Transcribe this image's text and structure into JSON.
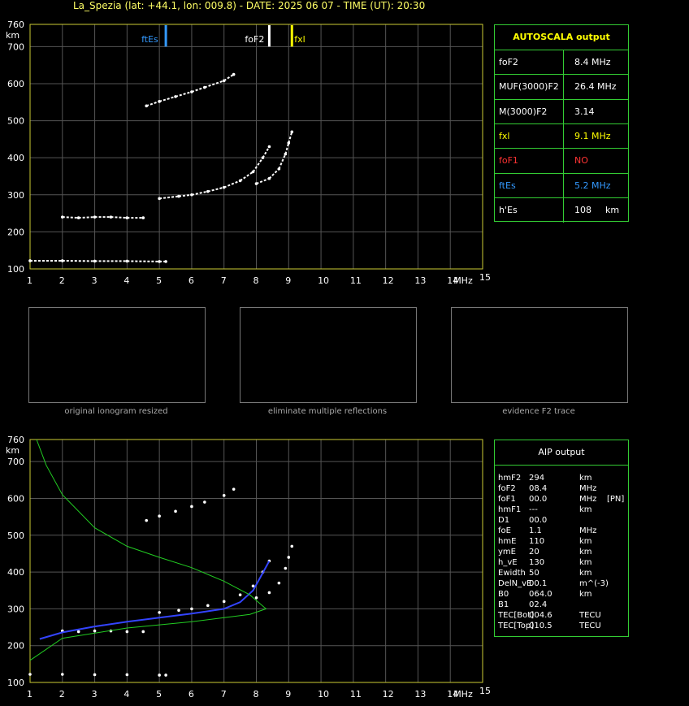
{
  "title": "La_Spezia (lat: +44.1, lon: 009.8) - DATE: 2025 06 07 - TIME (UT): 20:30",
  "axis": {
    "y_unit": "km",
    "x_unit": "MHz",
    "y_ticks": [
      "100",
      "200",
      "300",
      "400",
      "500",
      "600",
      "700",
      "760"
    ],
    "x_ticks": [
      "1",
      "2",
      "3",
      "4",
      "5",
      "6",
      "7",
      "8",
      "9",
      "10",
      "11",
      "12",
      "13",
      "14",
      "15"
    ]
  },
  "markers": {
    "ftEs": {
      "label": "ftEs",
      "freq": 5.2,
      "color": "#3399ff"
    },
    "foF2": {
      "label": "foF2",
      "freq": 8.4,
      "color": "#ffffff"
    },
    "fxl": {
      "label": "fxl",
      "freq": 9.1,
      "color": "#ffff00"
    }
  },
  "autoscala": {
    "header": "AUTOSCALA output",
    "rows": [
      {
        "name": "foF2",
        "value": "8.4 MHz",
        "name_color": "#ffffff",
        "value_color": "#ffffff"
      },
      {
        "name": "MUF(3000)F2",
        "value": "26.4 MHz",
        "name_color": "#ffffff",
        "value_color": "#ffffff"
      },
      {
        "name": "M(3000)F2",
        "value": "3.14",
        "name_color": "#ffffff",
        "value_color": "#ffffff"
      },
      {
        "name": "fxl",
        "value": "9.1 MHz",
        "name_color": "#ffff00",
        "value_color": "#ffff00"
      },
      {
        "name": "foF1",
        "value": "NO",
        "name_color": "#ff3333",
        "value_color": "#ff3333"
      },
      {
        "name": "ftEs",
        "value": "5.2 MHz",
        "name_color": "#3399ff",
        "value_color": "#3399ff"
      },
      {
        "name": "h'Es",
        "value": "108",
        "unit": "km",
        "name_color": "#ffffff",
        "value_color": "#ffffff"
      }
    ]
  },
  "thumb_captions": [
    "original ionogram resized",
    "eliminate multiple reflections",
    "evidence F2 trace"
  ],
  "aip": {
    "header": "AIP output",
    "rows": [
      {
        "name": "hmF2",
        "value": "294",
        "unit": "km",
        "extra": ""
      },
      {
        "name": "foF2",
        "value": "08.4",
        "unit": "MHz",
        "extra": ""
      },
      {
        "name": "foF1",
        "value": "00.0",
        "unit": "MHz",
        "extra": "[PN]"
      },
      {
        "name": "hmF1",
        "value": "---",
        "unit": "km",
        "extra": ""
      },
      {
        "name": "D1",
        "value": "00.0",
        "unit": "",
        "extra": ""
      },
      {
        "name": "foE",
        "value": "1.1",
        "unit": "MHz",
        "extra": ""
      },
      {
        "name": "hmE",
        "value": "110",
        "unit": "km",
        "extra": ""
      },
      {
        "name": "ymE",
        "value": "20",
        "unit": "km",
        "extra": ""
      },
      {
        "name": "h_vE",
        "value": "130",
        "unit": "km",
        "extra": ""
      },
      {
        "name": "Ewidth",
        "value": "50",
        "unit": "km",
        "extra": ""
      },
      {
        "name": "DelN_vE",
        "value": "00.1",
        "unit": "m^(-3)",
        "extra": ""
      },
      {
        "name": "B0",
        "value": "064.0",
        "unit": "km",
        "extra": ""
      },
      {
        "name": "B1",
        "value": "02.4",
        "unit": "",
        "extra": ""
      },
      {
        "name": "TEC[Bot]",
        "value": "004.6",
        "unit": "TECU",
        "extra": ""
      },
      {
        "name": "TEC[Top]",
        "value": "010.5",
        "unit": "TECU",
        "extra": ""
      }
    ]
  },
  "chart_data": [
    {
      "type": "scatter",
      "xlabel": "MHz",
      "ylabel": "km",
      "xlim": [
        1,
        15
      ],
      "ylim": [
        100,
        760
      ],
      "series": [
        {
          "values": [
            [
              4.6,
              540
            ],
            [
              5.0,
              552
            ],
            [
              5.5,
              565
            ],
            [
              6.0,
              578
            ],
            [
              6.4,
              590
            ],
            [
              7.0,
              608
            ],
            [
              7.3,
              625
            ]
          ]
        },
        {
          "values": [
            [
              5.0,
              290
            ],
            [
              5.6,
              296
            ],
            [
              6.0,
              300
            ],
            [
              6.5,
              309
            ],
            [
              7.0,
              320
            ],
            [
              7.5,
              338
            ],
            [
              7.9,
              362
            ],
            [
              8.2,
              400
            ],
            [
              8.4,
              430
            ]
          ]
        },
        {
          "values": [
            [
              8.0,
              330
            ],
            [
              8.4,
              344
            ],
            [
              8.7,
              370
            ],
            [
              8.9,
              410
            ],
            [
              9.0,
              440
            ],
            [
              9.1,
              470
            ]
          ]
        },
        {
          "values": [
            [
              2.0,
              240
            ],
            [
              2.5,
              238
            ],
            [
              3.0,
              240
            ],
            [
              3.5,
              240
            ],
            [
              4.0,
              238
            ],
            [
              4.5,
              238
            ]
          ]
        },
        {
          "values": [
            [
              1.0,
              122
            ],
            [
              2.0,
              122
            ],
            [
              3.0,
              121
            ],
            [
              4.0,
              121
            ],
            [
              5.0,
              120
            ],
            [
              5.2,
              120
            ]
          ]
        }
      ]
    },
    {
      "type": "line",
      "xlabel": "MHz",
      "ylabel": "km",
      "xlim": [
        1,
        15
      ],
      "ylim": [
        100,
        760
      ],
      "series": [
        {
          "values": [
            [
              1.3,
              218
            ],
            [
              2.0,
              236
            ],
            [
              3.0,
              252
            ],
            [
              4.0,
              265
            ],
            [
              5.0,
              276
            ],
            [
              6.0,
              287
            ],
            [
              7.0,
              300
            ],
            [
              7.5,
              318
            ],
            [
              7.9,
              350
            ],
            [
              8.2,
              398
            ],
            [
              8.4,
              430
            ]
          ]
        },
        {
          "values": [
            [
              1.2,
              760
            ],
            [
              1.5,
              690
            ],
            [
              2.0,
              610
            ],
            [
              3.0,
              520
            ],
            [
              4.0,
              470
            ],
            [
              5.0,
              440
            ],
            [
              6.0,
              412
            ],
            [
              7.0,
              375
            ],
            [
              7.8,
              338
            ],
            [
              8.3,
              300
            ],
            [
              7.8,
              285
            ],
            [
              6.0,
              265
            ],
            [
              4.0,
              248
            ],
            [
              2.0,
              220
            ],
            [
              1.0,
              160
            ]
          ]
        }
      ]
    }
  ]
}
